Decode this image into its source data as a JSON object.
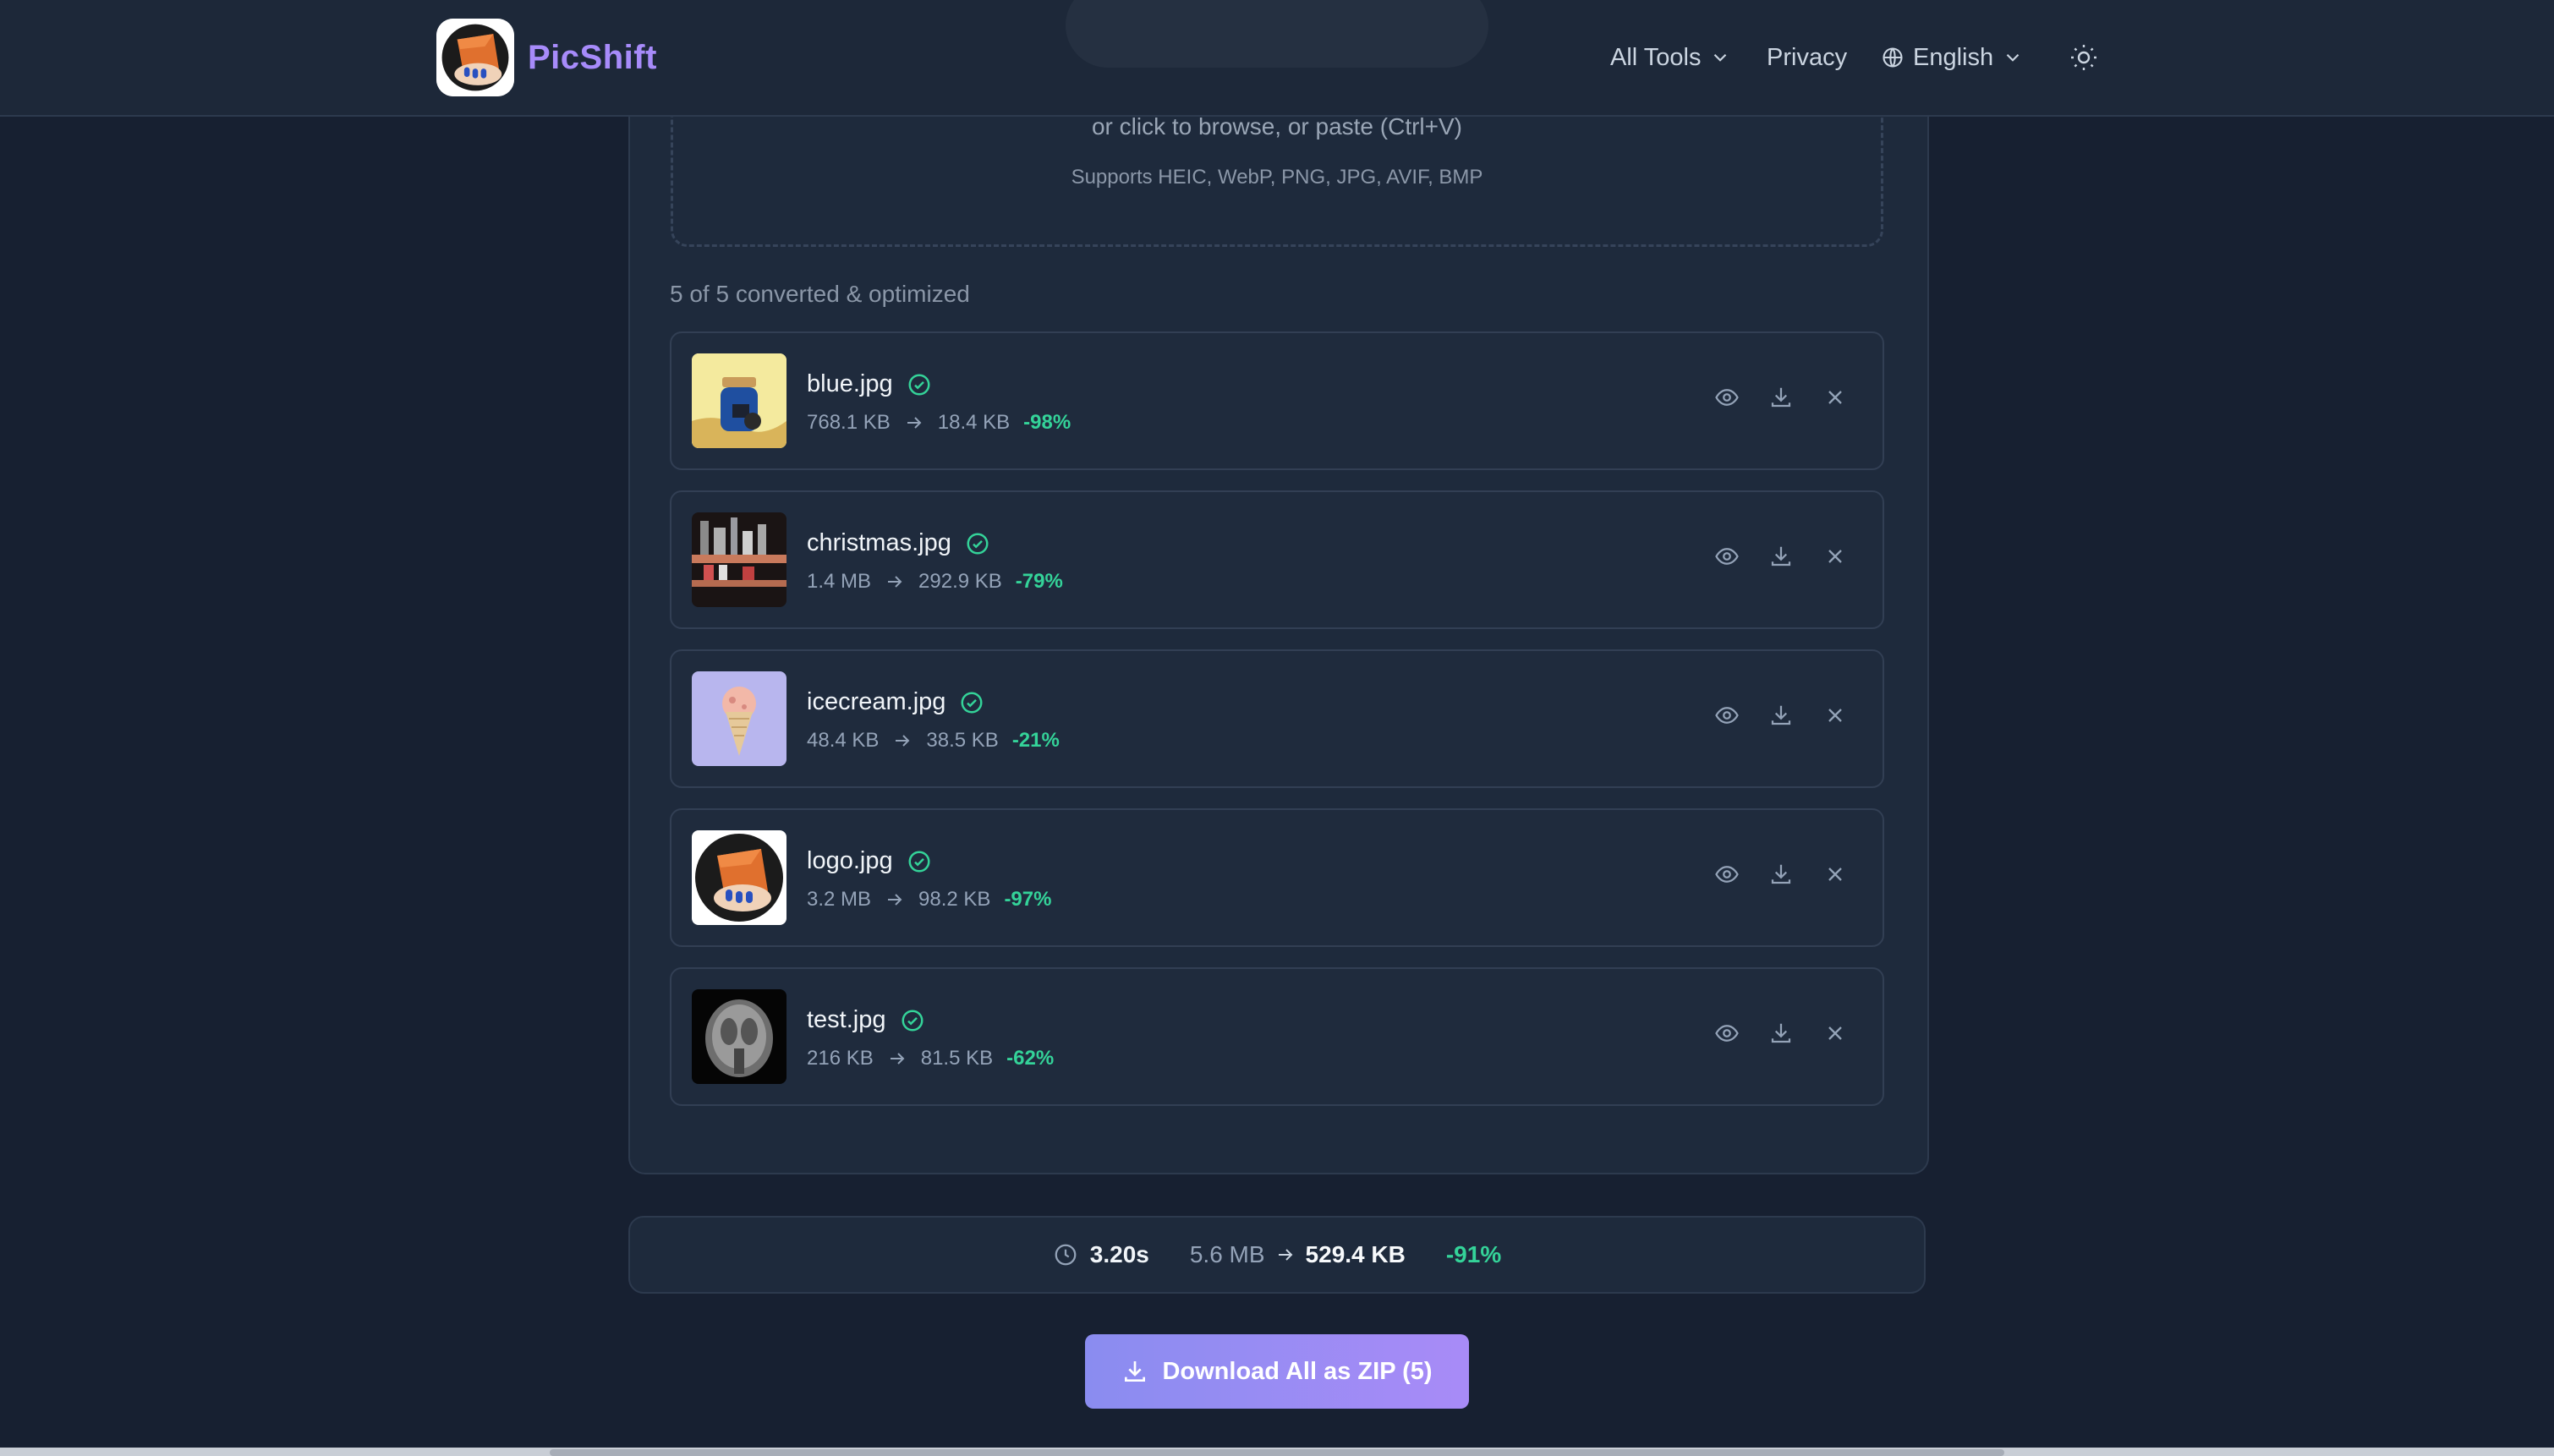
{
  "brand": {
    "name": "PicShift"
  },
  "nav": {
    "all_tools": "All Tools",
    "privacy": "Privacy",
    "language": "English"
  },
  "dropzone": {
    "hint": "or click to browse, or paste (Ctrl+V)",
    "formats": "Supports HEIC, WebP, PNG, JPG, AVIF, BMP"
  },
  "status": {
    "count_text": "5 of 5 converted & optimized"
  },
  "files": [
    {
      "name": "blue.jpg",
      "original": "768.1 KB",
      "optimized": "18.4 KB",
      "reduction": "-98%",
      "thumbnail": "blue-jar-thumbnail"
    },
    {
      "name": "christmas.jpg",
      "original": "1.4 MB",
      "optimized": "292.9 KB",
      "reduction": "-79%",
      "thumbnail": "shelf-thumbnail"
    },
    {
      "name": "icecream.jpg",
      "original": "48.4 KB",
      "optimized": "38.5 KB",
      "reduction": "-21%",
      "thumbnail": "icecream-thumbnail"
    },
    {
      "name": "logo.jpg",
      "original": "3.2 MB",
      "optimized": "98.2 KB",
      "reduction": "-97%",
      "thumbnail": "logo-thumbnail"
    },
    {
      "name": "test.jpg",
      "original": "216 KB",
      "optimized": "81.5 KB",
      "reduction": "-62%",
      "thumbnail": "mri-thumbnail"
    }
  ],
  "summary": {
    "time": "3.20s",
    "original": "5.6 MB",
    "optimized": "529.4 KB",
    "reduction": "-91%"
  },
  "download_all": {
    "label": "Download All as ZIP (5)"
  },
  "colors": {
    "accent": "#a78bfa",
    "success": "#34d399",
    "background": "#172031",
    "button_gradient_start": "#8a8cf0",
    "button_gradient_end": "#a88bf7"
  }
}
